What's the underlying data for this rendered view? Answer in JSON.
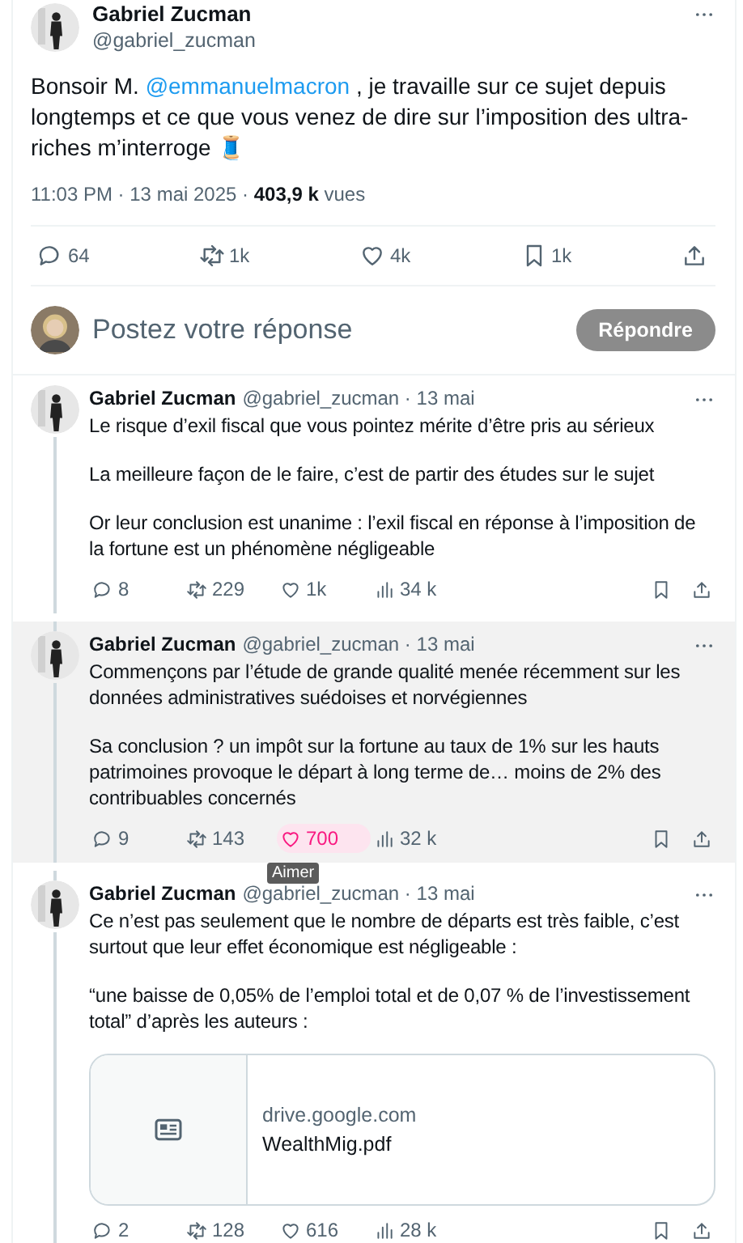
{
  "tweet": {
    "author": "Gabriel Zucman",
    "handle": "@gabriel_zucman",
    "text_parts": [
      {
        "kind": "text",
        "text": "Bonsoir M. "
      },
      {
        "kind": "mention",
        "text": "@emmanuelmacron"
      },
      {
        "kind": "text",
        "text": " , je travaille sur ce sujet depuis longtemps et ce que vous venez de dire sur l’imposition des ultra-riches m’interroge 🧵"
      }
    ],
    "meta": "11:03 PM · 13 mai 2025 · **403,9 k** vues",
    "stats": [
      {
        "kind": "reply",
        "count": "64"
      },
      {
        "kind": "retweet",
        "count": "1k"
      },
      {
        "kind": "like",
        "count": "4k"
      },
      {
        "kind": "bookmark",
        "count": "1k"
      },
      {
        "kind": "share"
      }
    ]
  },
  "composer": {
    "placeholder": "Postez votre réponse",
    "button": "Répondre",
    "disabled": true
  },
  "replies": [
    {
      "author": "Gabriel Zucman",
      "meta": "@gabriel_zucman · 13 mai",
      "highlighted": false,
      "paragraphs": [
        "Le risque d’exil fiscal que vous pointez mérite d’être pris au sérieux",
        "La meilleure façon de le faire, c’est de partir des études sur le sujet",
        "Or leur conclusion est unanime : l’exil fiscal en réponse à l’imposition de la fortune est un phénomène négligeable"
      ],
      "stats": [
        {
          "kind": "reply",
          "count": "8",
          "active": false
        },
        {
          "kind": "retweet",
          "count": "229",
          "active": false
        },
        {
          "kind": "like",
          "count": "1k",
          "active": false
        },
        {
          "kind": "views",
          "count": "34 k",
          "active": false
        }
      ]
    },
    {
      "author": "Gabriel Zucman",
      "meta": "@gabriel_zucman · 13 mai",
      "highlighted": true,
      "paragraphs": [
        "Commençons par l’étude de grande qualité menée récemment sur les données administratives suédoises et norvégiennes",
        "Sa conclusion ? un impôt sur la fortune au taux de 1% sur les hauts patrimoines provoque le départ à long terme de… moins de 2% des contribuables concernés"
      ],
      "stats": [
        {
          "kind": "reply",
          "count": "9",
          "active": false
        },
        {
          "kind": "retweet",
          "count": "143",
          "active": false
        },
        {
          "kind": "like",
          "count": "700",
          "active": true,
          "tooltip": "Aimer"
        },
        {
          "kind": "views",
          "count": "32 k",
          "active": false
        }
      ]
    },
    {
      "author": "Gabriel Zucman",
      "meta": "@gabriel_zucman · 13 mai",
      "highlighted": false,
      "paragraphs": [
        "Ce n’est pas seulement que le nombre de départs est très faible, c’est surtout que leur effet économique est négligeable :",
        "“une baisse de 0,05% de l’emploi total et de 0,07 % de l’investissement total” d’après les auteurs :"
      ],
      "link_card": {
        "domain": "drive.google.com",
        "title": "WealthMig.pdf"
      },
      "stats": [
        {
          "kind": "reply",
          "count": "2",
          "active": false
        },
        {
          "kind": "retweet",
          "count": "128",
          "active": false
        },
        {
          "kind": "like",
          "count": "616",
          "active": false
        },
        {
          "kind": "views",
          "count": "28 k",
          "active": false
        }
      ]
    }
  ]
}
